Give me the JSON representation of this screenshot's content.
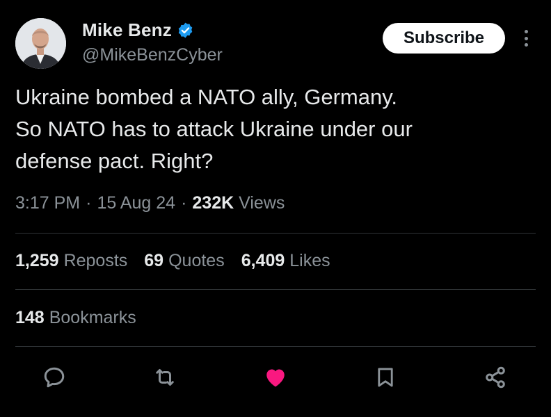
{
  "author": {
    "display_name": "Mike Benz",
    "handle": "@MikeBenzCyber",
    "verified": true,
    "verified_color": "#1d9bf0"
  },
  "header": {
    "subscribe_label": "Subscribe",
    "more_icon": "more-vertical-icon"
  },
  "tweet": {
    "lines": [
      "Ukraine bombed a NATO ally, Germany.",
      "So NATO has to attack Ukraine under our",
      "defense pact. Right?"
    ],
    "time": "3:17 PM",
    "date": "15 Aug 24",
    "separator": "·",
    "views_count": "232K",
    "views_label": "Views"
  },
  "stats": {
    "reposts_count": "1,259",
    "reposts_label": "Reposts",
    "quotes_count": "69",
    "quotes_label": "Quotes",
    "likes_count": "6,409",
    "likes_label": "Likes",
    "bookmarks_count": "148",
    "bookmarks_label": "Bookmarks"
  },
  "actions": [
    {
      "icon": "reply-icon"
    },
    {
      "icon": "repost-icon"
    },
    {
      "icon": "like-icon",
      "active": true,
      "color": "#f91880"
    },
    {
      "icon": "bookmark-icon"
    },
    {
      "icon": "share-icon"
    }
  ],
  "colors": {
    "background": "#000000",
    "text": "#e7e9ea",
    "muted": "#8b9298",
    "divider": "#2f3336",
    "like_active": "#f91880"
  }
}
